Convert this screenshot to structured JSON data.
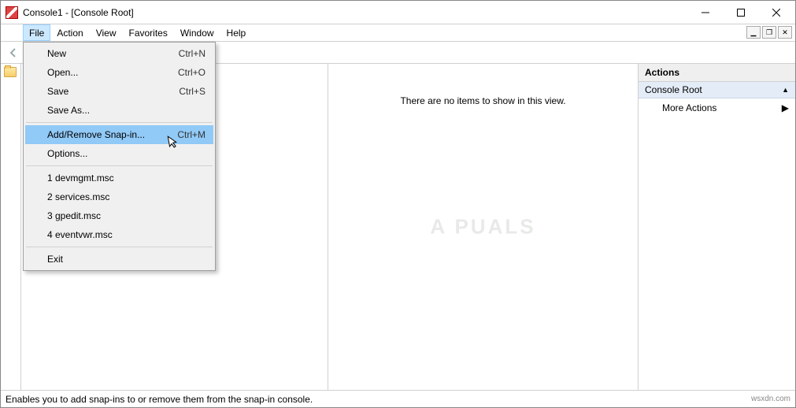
{
  "window": {
    "title": "Console1 - [Console Root]"
  },
  "menubar": {
    "items": [
      "File",
      "Action",
      "View",
      "Favorites",
      "Window",
      "Help"
    ],
    "open_index": 0
  },
  "file_menu": {
    "groups": [
      [
        {
          "label": "New",
          "shortcut": "Ctrl+N"
        },
        {
          "label": "Open...",
          "shortcut": "Ctrl+O"
        },
        {
          "label": "Save",
          "shortcut": "Ctrl+S"
        },
        {
          "label": "Save As...",
          "shortcut": ""
        }
      ],
      [
        {
          "label": "Add/Remove Snap-in...",
          "shortcut": "Ctrl+M",
          "highlight": true
        },
        {
          "label": "Options...",
          "shortcut": ""
        }
      ],
      [
        {
          "label": "1 devmgmt.msc",
          "shortcut": ""
        },
        {
          "label": "2 services.msc",
          "shortcut": ""
        },
        {
          "label": "3 gpedit.msc",
          "shortcut": ""
        },
        {
          "label": "4 eventvwr.msc",
          "shortcut": ""
        }
      ],
      [
        {
          "label": "Exit",
          "shortcut": ""
        }
      ]
    ]
  },
  "main": {
    "empty_text": "There are no items to show in this view."
  },
  "actions": {
    "header": "Actions",
    "group": "Console Root",
    "more": "More Actions"
  },
  "statusbar": {
    "text": "Enables you to add snap-ins to or remove them from the snap-in console."
  },
  "attribution": "wsxdn.com",
  "watermark": "A   PUALS"
}
